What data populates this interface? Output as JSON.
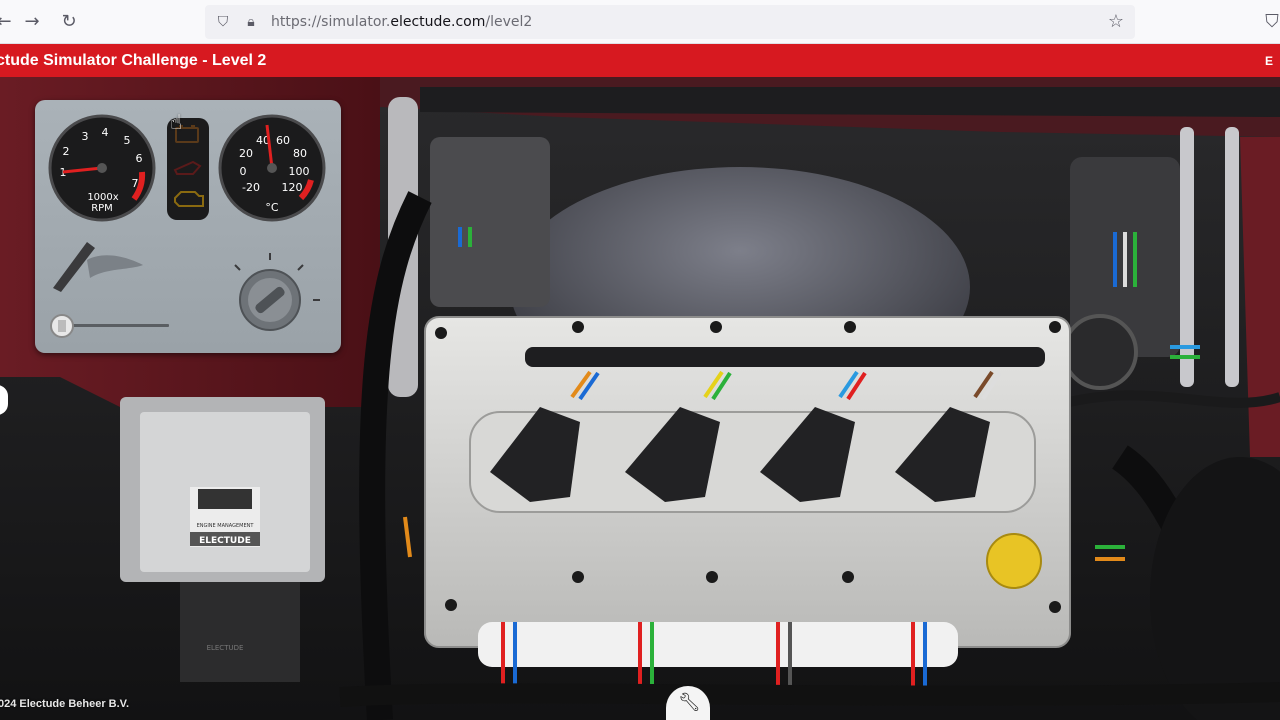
{
  "browser": {
    "url_prefix": "https://simulator.",
    "url_host": "electude.com",
    "url_path": "/level2",
    "icons": [
      "back-arrow-icon",
      "forward-arrow-icon",
      "reload-icon",
      "shield-icon",
      "lock-icon",
      "bookmark-star-icon",
      "pocket-icon"
    ]
  },
  "app": {
    "title": "ctude Simulator Challenge - Level 2",
    "logo": "E",
    "accent_color": "#d71920"
  },
  "dashboard": {
    "rpm_gauge": {
      "ticks": [
        "1",
        "2",
        "3",
        "4",
        "5",
        "6",
        "7"
      ],
      "label_top": "1000x",
      "label_bottom": "RPM",
      "value": 0
    },
    "temp_gauge": {
      "ticks": [
        "-20",
        "0",
        "20",
        "40",
        "60",
        "80",
        "100",
        "120"
      ],
      "unit": "°C",
      "value": 40
    },
    "warning_lights": [
      "battery-warning-icon",
      "oil-pressure-warning-icon",
      "check-engine-warning-icon"
    ]
  },
  "ecu": {
    "label_top": "ENGINE MANAGEMENT",
    "brand": "ELECTUDE",
    "bottom_label": "ELECTUDE"
  },
  "footer": {
    "copyright": "024 Electude Beheer B.V."
  }
}
